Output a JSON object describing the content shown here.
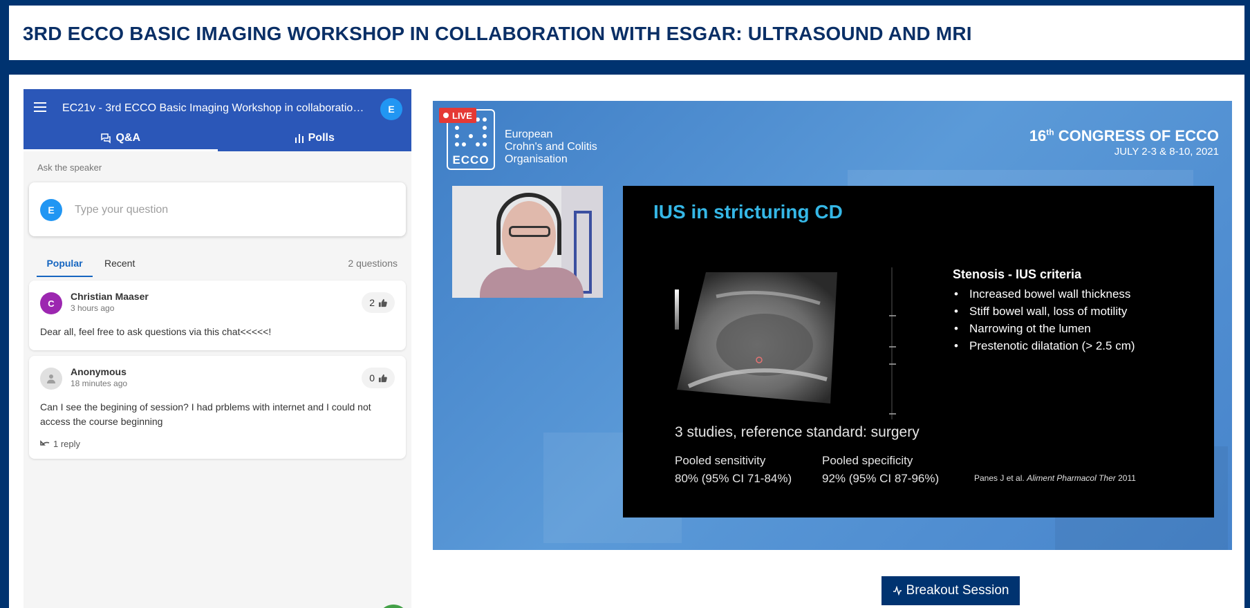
{
  "page": {
    "title": "3RD ECCO BASIC IMAGING WORKSHOP IN COLLABORATION WITH ESGAR: ULTRASOUND AND MRI"
  },
  "chat": {
    "header_title": "EC21v - 3rd ECCO Basic Imaging Workshop in collaboration w...",
    "user_initial": "E",
    "tabs": [
      {
        "label": "Q&A",
        "icon": "speech-bubbles-icon",
        "active": true
      },
      {
        "label": "Polls",
        "icon": "bar-chart-icon",
        "active": false
      }
    ],
    "ask_label": "Ask the speaker",
    "input_placeholder": "Type your question",
    "filters": {
      "popular": "Popular",
      "recent": "Recent"
    },
    "question_count": "2 questions",
    "questions": [
      {
        "author": "Christian Maaser",
        "initial": "C",
        "time": "3 hours ago",
        "likes": "2",
        "text": "Dear all, feel free to ask questions via this chat<<<<<!"
      },
      {
        "author": "Anonymous",
        "initial": "",
        "time": "18 minutes ago",
        "likes": "0",
        "text": "Can I see the begining of session? I had prblems with internet and I could not access the course beginning",
        "replies": "1 reply"
      }
    ]
  },
  "video": {
    "live_label": "LIVE",
    "logo_wordmark": "ECCO",
    "org_lines": [
      "European",
      "Crohn's and Colitis",
      "Organisation"
    ],
    "congress_ordinal": "16",
    "congress_suffix": "th",
    "congress_name": "CONGRESS OF ECCO",
    "congress_dates": "JULY 2-3 & 8-10, 2021",
    "slide": {
      "title": "IUS in stricturing CD",
      "criteria_title": "Stenosis - IUS criteria",
      "criteria": [
        "Increased bowel wall thickness",
        "Stiff bowel wall, loss of motility",
        "Narrowing ot the lumen",
        "Prestenotic dilatation (> 2.5 cm)"
      ],
      "studies": "3 studies, reference standard: surgery",
      "sensitivity_label": "Pooled sensitivity",
      "sensitivity_value": "80% (95% CI 71-84%)",
      "specificity_label": "Pooled specificity",
      "specificity_value": "92% (95% CI 87-96%)",
      "reference_authors": "Panes J et al.",
      "reference_journal": "Aliment Pharmacol Ther",
      "reference_year": "2011"
    }
  },
  "breakout": {
    "label": "Breakout Session",
    "icon": "pulse-icon"
  },
  "colors": {
    "page_background": "#003370",
    "chat_header": "#2b57b8",
    "accent_blue": "#2196f3",
    "live_red": "#e53935",
    "slide_title": "#35b7e6"
  }
}
